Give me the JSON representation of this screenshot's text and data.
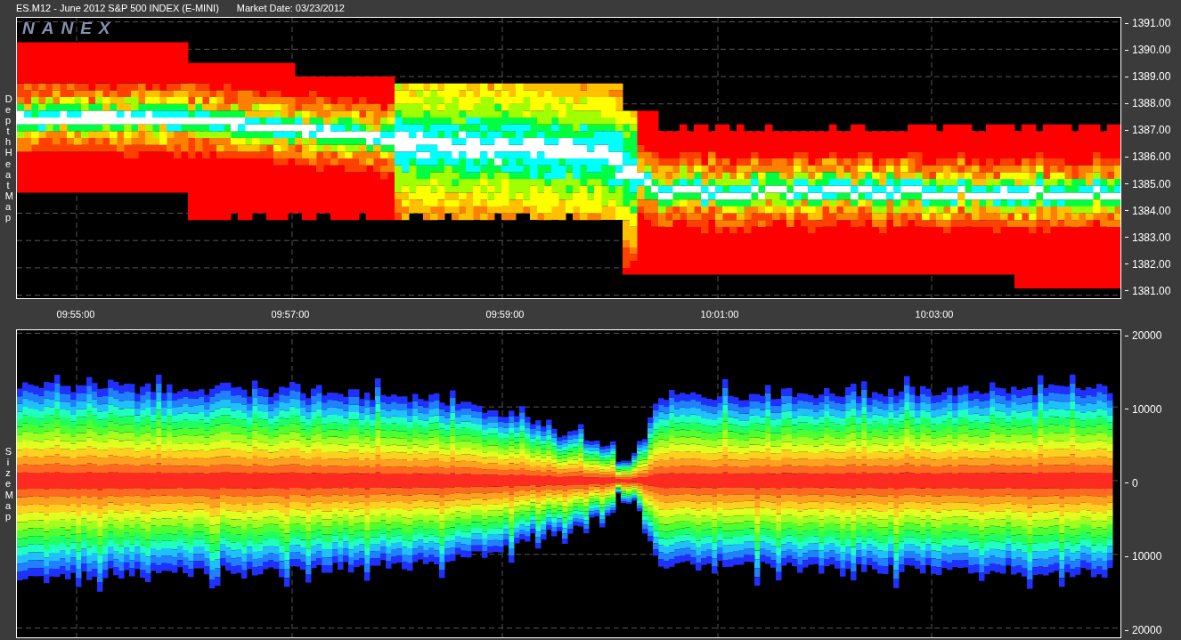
{
  "window": {
    "title": "ES.M12 - June 2012 S&P 500 INDEX (E-MINI)",
    "market_date": "Market Date: 03/23/2012"
  },
  "logo": "NANEX",
  "panels": [
    {
      "kind": "depth",
      "label": "Depth Heat Map",
      "y_ticks": [
        "1391.00",
        "1390.00",
        "1389.00",
        "1388.00",
        "1387.00",
        "1386.00",
        "1385.00",
        "1384.00",
        "1383.00",
        "1382.00",
        "1381.00"
      ]
    },
    {
      "kind": "size",
      "label": "Size Map",
      "y_ticks": [
        "20000",
        "10000",
        "0",
        "10000",
        "20000"
      ]
    }
  ],
  "time_ticks": [
    "09:55:00",
    "09:57:00",
    "09:59:00",
    "10:01:00",
    "10:03:00"
  ]
}
